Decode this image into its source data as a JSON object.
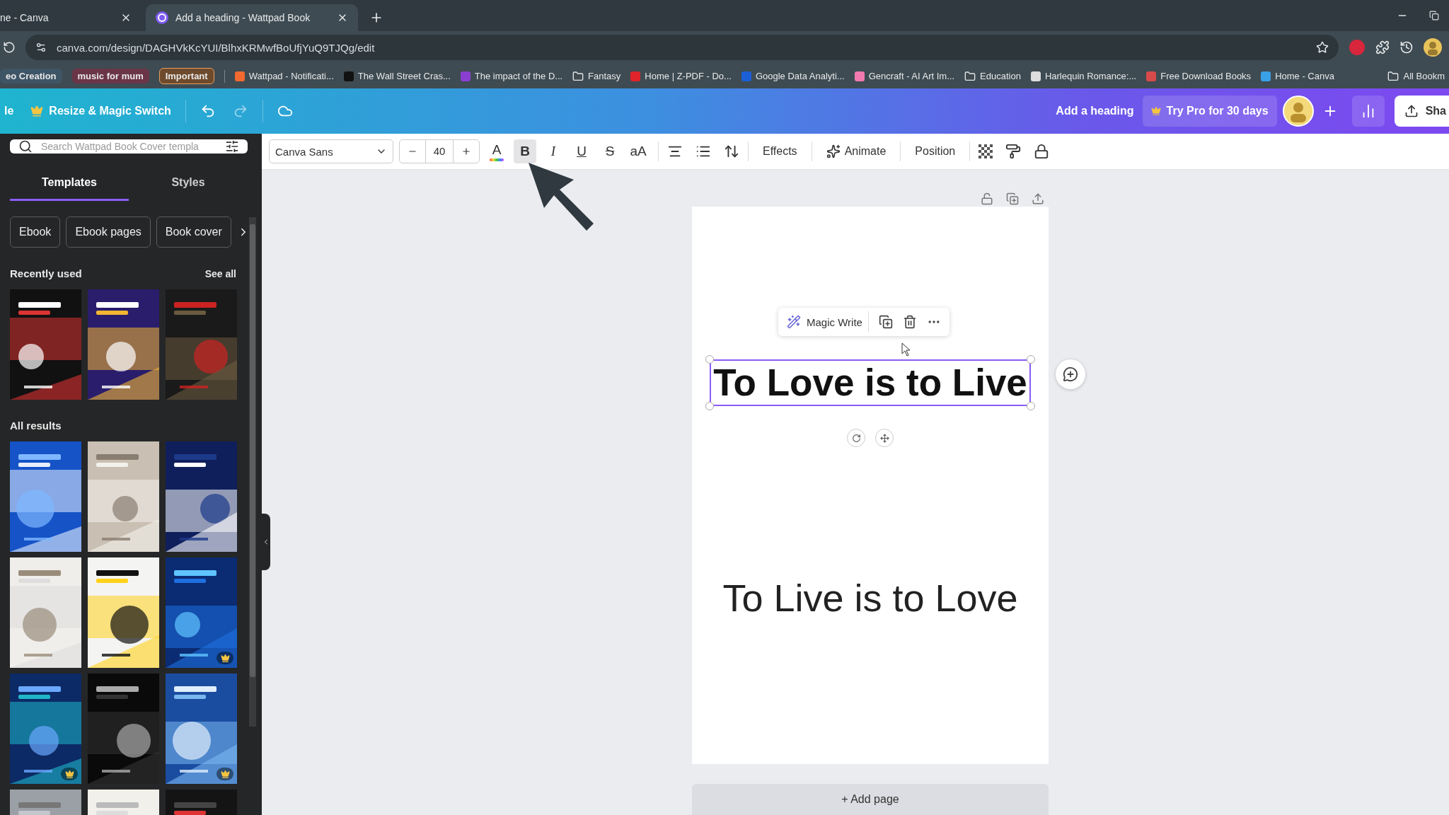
{
  "browser": {
    "tabs": [
      {
        "title": "ne - Canva",
        "selected": false
      },
      {
        "title": "Add a heading - Wattpad Book",
        "selected": true
      }
    ],
    "url": "canva.com/design/DAGHVkKcYUI/BlhxKRMwfBoUfjYuQ9TJQg/edit",
    "bookmarks": [
      {
        "kind": "group",
        "label": "eo Creation",
        "color": "#3e5566"
      },
      {
        "kind": "group",
        "label": "music for mum",
        "color": "#6b3548"
      },
      {
        "kind": "group",
        "label": "Important",
        "color": "#6e4a2c"
      },
      {
        "kind": "site",
        "label": "Wattpad - Notificati...",
        "color": "#f2692f"
      },
      {
        "kind": "site",
        "label": "The Wall Street Cras...",
        "color": "#111111"
      },
      {
        "kind": "site",
        "label": "The impact of the D...",
        "color": "#8a3fd1"
      },
      {
        "kind": "folder",
        "label": "Fantasy"
      },
      {
        "kind": "site",
        "label": "Home | Z-PDF - Do...",
        "color": "#e0242a"
      },
      {
        "kind": "site",
        "label": "Google Data Analyti...",
        "color": "#1a5fd6"
      },
      {
        "kind": "site",
        "label": "Gencraft - AI Art Im...",
        "color": "#f07ab0"
      },
      {
        "kind": "folder",
        "label": "Education"
      },
      {
        "kind": "site",
        "label": "Harlequin Romance:...",
        "color": "#dddddd"
      },
      {
        "kind": "site",
        "label": "Free Download Books",
        "color": "#d84a4a"
      },
      {
        "kind": "site",
        "label": "Home - Canva",
        "color": "#3aa0e8"
      },
      {
        "kind": "folder",
        "label": "All Bookm"
      }
    ]
  },
  "header": {
    "file_menu": "le",
    "resize_button": "Resize & Magic Switch",
    "design_title": "Add a heading",
    "pro_button": "Try Pro for 30 days",
    "share_button": "Sha"
  },
  "toolbar": {
    "font": "Canva Sans",
    "font_size": "40",
    "format_buttons": [
      {
        "kind": "color",
        "label": "A",
        "selected": false
      },
      {
        "kind": "bold",
        "label": "B",
        "selected": true
      },
      {
        "kind": "italic",
        "label": "I",
        "selected": false
      },
      {
        "kind": "underline",
        "label": "U",
        "selected": false
      },
      {
        "kind": "strike",
        "label": "S",
        "selected": false
      },
      {
        "kind": "case",
        "label": "aA",
        "selected": false
      }
    ],
    "effects": "Effects",
    "animate": "Animate",
    "position": "Position"
  },
  "sidebar": {
    "search": {
      "placeholder": "Search Wattpad Book Cover templa"
    },
    "tabs": [
      {
        "label": "Templates",
        "selected": true
      },
      {
        "label": "Styles",
        "selected": false
      }
    ],
    "chips": [
      "Ebook",
      "Ebook pages",
      "Book cover"
    ],
    "recent": {
      "title": "Recently used",
      "link": "See all",
      "items": [
        {
          "kind": "picture",
          "premium": false
        },
        {
          "kind": "picture",
          "premium": false
        },
        {
          "kind": "picture",
          "premium": false
        }
      ]
    },
    "results": {
      "title": "All results",
      "items": [
        {
          "kind": "picture",
          "premium": false
        },
        {
          "kind": "picture",
          "premium": false
        },
        {
          "kind": "picture",
          "premium": false
        },
        {
          "kind": "picture",
          "premium": false
        },
        {
          "kind": "picture",
          "premium": false
        },
        {
          "kind": "picture",
          "premium": true
        },
        {
          "kind": "picture",
          "premium": true
        },
        {
          "kind": "picture",
          "premium": false
        },
        {
          "kind": "picture",
          "premium": true
        },
        {
          "kind": "picture",
          "premium": false
        },
        {
          "kind": "picture",
          "premium": false
        },
        {
          "kind": "picture",
          "premium": false
        }
      ]
    }
  },
  "canvas": {
    "magic_write": "Magic Write",
    "heading": {
      "text": "To Love is to Live",
      "selected": true
    },
    "body": {
      "text": "To Live is to Love",
      "selected": false
    },
    "add_page": "+ Add page"
  }
}
